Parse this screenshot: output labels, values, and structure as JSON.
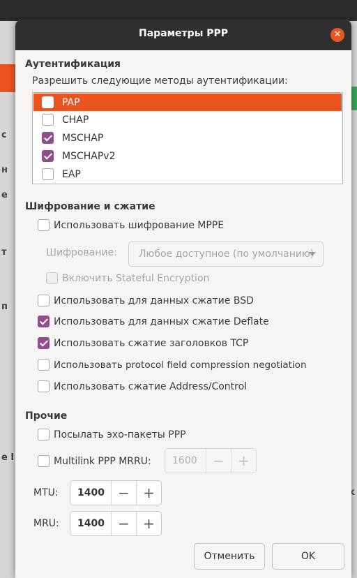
{
  "background": {
    "fragments": [
      "с",
      "н",
      "e",
      "т",
      "п",
      "e I",
      "k"
    ]
  },
  "dialog": {
    "title": "Параметры PPP",
    "close_icon": "close-icon"
  },
  "auth": {
    "section_title": "Аутентификация",
    "allow_label": "Разрешить следующие методы аутентификации:",
    "methods": [
      {
        "label": "PAP",
        "checked": false,
        "selected": true
      },
      {
        "label": "CHAP",
        "checked": false,
        "selected": false
      },
      {
        "label": "MSCHAP",
        "checked": true,
        "selected": false
      },
      {
        "label": "MSCHAPv2",
        "checked": true,
        "selected": false
      },
      {
        "label": "EAP",
        "checked": false,
        "selected": false
      }
    ]
  },
  "encryption": {
    "section_title": "Шифрование и сжатие",
    "use_mppe": "Использовать шифрование MPPE",
    "cipher_label": "Шифрование:",
    "cipher_value": "Любое доступное (по умолчанию)",
    "stateful": "Включить Stateful Encryption",
    "bsd": "Использовать для данных сжатие BSD",
    "deflate": "Использовать для данных сжатие Deflate",
    "tcp_header": "Использовать сжатие заголовков TCP",
    "protocol_field": "Использовать protocol field compression negotiation",
    "address_control": "Использовать сжатие Address/Control"
  },
  "misc": {
    "section_title": "Прочие",
    "echo": "Посылать эхо-пакеты PPP",
    "multilink": "Multilink PPP MRRU:",
    "mrru_value": "1600",
    "mtu_label": "MTU:",
    "mtu_value": "1400",
    "mru_label": "MRU:",
    "mru_value": "1400",
    "minus": "−",
    "plus": "+"
  },
  "buttons": {
    "cancel": "Отменить",
    "ok": "OK"
  },
  "colors": {
    "accent": "#e95420",
    "check": "#924d8b"
  }
}
